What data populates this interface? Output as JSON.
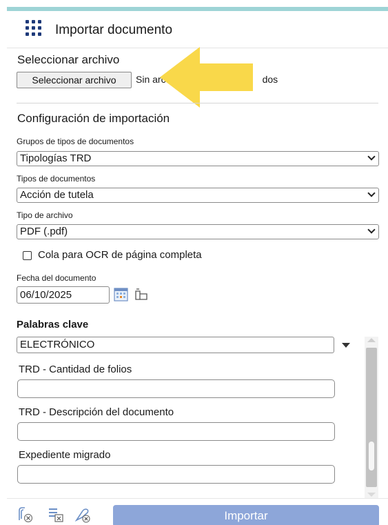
{
  "header": {
    "title": "Importar documento",
    "icon": "apps-grid-icon",
    "accent_color": "#9ed4d6",
    "icon_color": "#1e3a7a"
  },
  "file_section": {
    "title": "Seleccionar archivo",
    "button_label": "Seleccionar archivo",
    "status_visible": "Sin arc",
    "status_tail": "dos"
  },
  "import_config": {
    "title": "Configuración de importación",
    "document_type_groups": {
      "label": "Grupos de tipos de documentos",
      "value": "Tipologías TRD"
    },
    "document_types": {
      "label": "Tipos de documentos",
      "value": "Acción de tutela"
    },
    "file_type": {
      "label": "Tipo de archivo",
      "value": "PDF (.pdf)"
    },
    "ocr_checkbox": {
      "label": "Cola para OCR de página completa",
      "checked": false
    },
    "document_date": {
      "label": "Fecha del documento",
      "value": "06/10/2025"
    }
  },
  "keywords": {
    "title": "Palabras clave",
    "value": "ELECTRÓNICO",
    "fields": [
      {
        "label": "TRD - Cantidad de folios",
        "value": ""
      },
      {
        "label": "TRD - Descripción del documento",
        "value": ""
      },
      {
        "label": "Expediente migrado",
        "value": ""
      }
    ]
  },
  "footer": {
    "import_label": "Importar",
    "import_color": "#8da6d9",
    "icons": [
      "clear-attachment-icon",
      "clear-list-icon",
      "clear-keywords-icon"
    ]
  },
  "annotation": {
    "arrow_color": "#f9d84a"
  }
}
